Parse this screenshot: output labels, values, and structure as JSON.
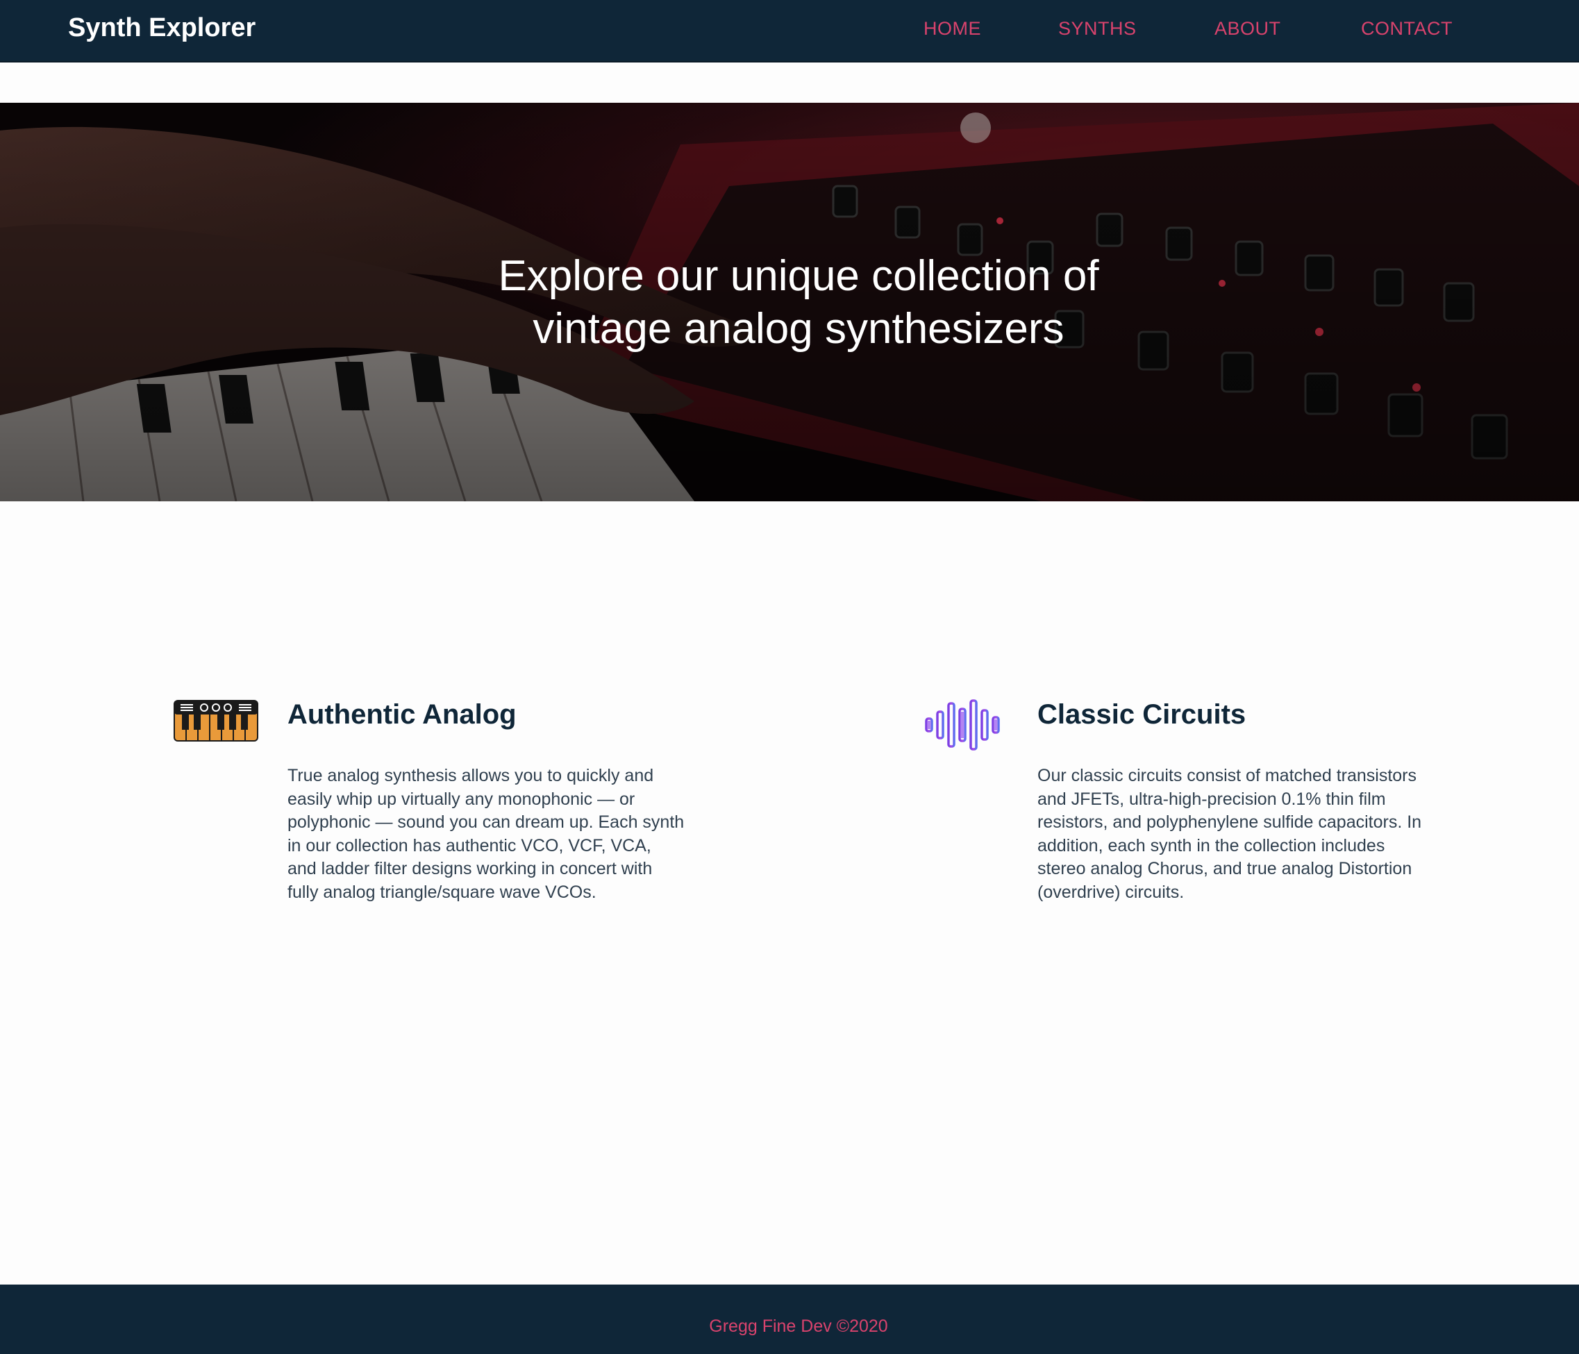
{
  "nav": {
    "brand": "Synth Explorer",
    "links": [
      {
        "label": "HOME"
      },
      {
        "label": "SYNTHS"
      },
      {
        "label": "ABOUT"
      },
      {
        "label": "CONTACT"
      }
    ]
  },
  "hero": {
    "title_line1": "Explore our unique collection of",
    "title_line2": "vintage analog synthesizers",
    "image": "hands playing a red analog synthesizer keyboard"
  },
  "features": [
    {
      "icon": "keyboard-icon",
      "title": "Authentic Analog",
      "text": "True analog synthesis allows you to quickly and easily whip up virtually any monophonic — or polyphonic — sound you can dream up. Each synth in our collection has authentic VCO, VCF, VCA, and ladder filter designs working in concert with fully analog triangle/square wave VCOs."
    },
    {
      "icon": "sound-wave-icon",
      "title": "Classic Circuits",
      "text": "Our classic circuits consist of matched transistors and JFETs, ultra-high-precision 0.1% thin film resistors, and polyphenylene sulfide capacitors. In addition, each synth in the collection includes stereo analog Chorus, and true analog Distortion (overdrive) circuits."
    }
  ],
  "footer": {
    "text": "Gregg Fine Dev ©2020"
  },
  "colors": {
    "navbar": "#0f2638",
    "accent": "#d9436d",
    "heading": "#0f2638",
    "body_text": "#2f3f4e"
  }
}
